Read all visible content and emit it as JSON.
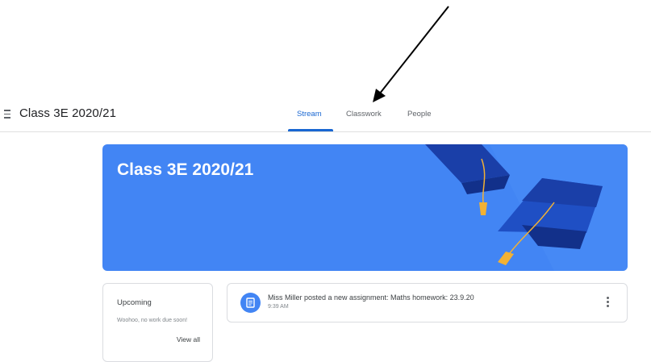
{
  "header": {
    "class_name": "Class 3E 2020/21",
    "tabs": [
      {
        "label": "Stream",
        "active": true
      },
      {
        "label": "Classwork",
        "active": false
      },
      {
        "label": "People",
        "active": false
      }
    ]
  },
  "banner": {
    "title": "Class 3E 2020/21",
    "color": "#4285f4"
  },
  "upcoming": {
    "title": "Upcoming",
    "empty_text": "Woohoo, no work due soon!",
    "view_all": "View all"
  },
  "stream": {
    "posts": [
      {
        "text": "Miss Miller posted a new assignment: Maths homework: 23.9.20",
        "time": "9:39 AM",
        "icon": "assignment-icon"
      }
    ]
  },
  "colors": {
    "accent": "#1967d2",
    "banner": "#4285f4",
    "cap_dark": "#1a3fa8",
    "tassel": "#f2b134"
  }
}
